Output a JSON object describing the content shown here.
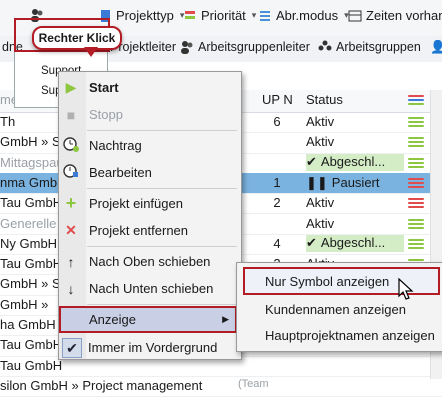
{
  "toolbar_top": {
    "items": [
      {
        "label": "Projekttyp"
      },
      {
        "label": "Priorität"
      },
      {
        "label": "Abr.modus"
      },
      {
        "label": "Zeiten vorhan"
      }
    ]
  },
  "toolbar_filter": {
    "items": [
      {
        "label": "Projektleiter"
      },
      {
        "label": "Arbeitsgruppenleiter"
      },
      {
        "label": "Arbeitsgruppen"
      }
    ]
  },
  "underlying_dropdown": {
    "items": [
      {
        "label": "Support"
      },
      {
        "label": "Sup"
      }
    ]
  },
  "callout": {
    "label": "Rechter Klick"
  },
  "grid": {
    "headers": {
      "up": "UP Nr.",
      "status": "Status"
    },
    "rows": [
      {
        "name": "Th",
        "up": "6",
        "status": "Aktiv"
      },
      {
        "name": "GmbH » S",
        "up": "",
        "status": "Aktiv"
      },
      {
        "name": "Mittagspause",
        "up": "",
        "status": "Abgeschl..."
      },
      {
        "name": "nma GmbH",
        "up": "1",
        "status": "Pausiert"
      },
      {
        "name": "Tau GmbH",
        "up": "2",
        "status": "Aktiv"
      },
      {
        "name": "Generelle",
        "up": "",
        "status": "Aktiv"
      },
      {
        "name": "Ny GmbH",
        "up": "4",
        "status": "Abgeschl..."
      },
      {
        "name": "Tau GmbH",
        "up": "2",
        "status": "Aktiv"
      },
      {
        "name": "GmbH » S",
        "up": "",
        "status": "Aktiv"
      },
      {
        "name": "GmbH »",
        "up": "",
        "status": ""
      },
      {
        "name": "ha GmbH",
        "up": "",
        "status": ""
      },
      {
        "name": "Tau GmbH",
        "up": "",
        "status": ""
      },
      {
        "name": "Tau GmbH",
        "up": "",
        "status": ""
      },
      {
        "name": "silon GmbH » Project management",
        "up": "",
        "status": ""
      }
    ],
    "row13_suffix": "(Team"
  },
  "context_menu": {
    "items": [
      {
        "label": "Start",
        "icon": "play-icon"
      },
      {
        "label": "Stopp",
        "icon": "stop-icon"
      },
      {
        "label": "Nachtrag",
        "icon": "clock-add-icon"
      },
      {
        "label": "Bearbeiten",
        "icon": "edit-icon"
      },
      {
        "label": "Projekt einfügen",
        "icon": "plus-icon"
      },
      {
        "label": "Projekt entfernen",
        "icon": "x-icon"
      },
      {
        "label": "Nach Oben schieben",
        "icon": "arrow-up-icon"
      },
      {
        "label": "Nach Unten schieben",
        "icon": "arrow-down-icon"
      },
      {
        "label": "Anzeige",
        "icon": ""
      },
      {
        "label": "Immer im Vordergrund",
        "icon": "check-icon"
      }
    ]
  },
  "submenu": {
    "items": [
      {
        "label": "Nur Symbol anzeigen"
      },
      {
        "label": "Kundennamen anzeigen"
      },
      {
        "label": "Hauptprojektnamen anzeigen"
      }
    ]
  },
  "colors": {
    "highlight_red": "#b31c24",
    "selected_row": "#7bb3e0",
    "green_status": "#8dc63f"
  }
}
